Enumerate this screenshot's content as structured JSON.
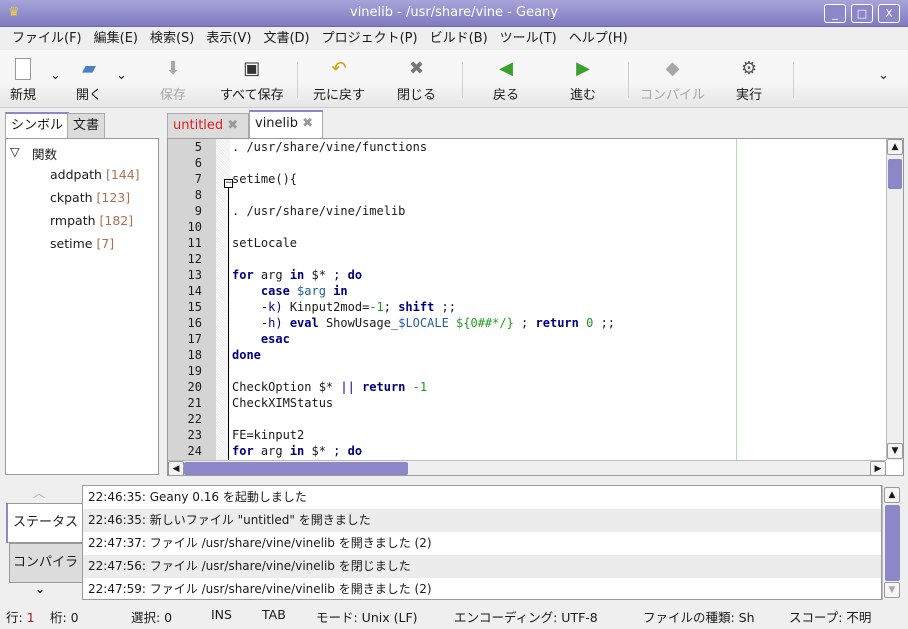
{
  "window": {
    "title": "vinelib - /usr/share/vine - Geany",
    "minimize": "_",
    "maximize": "□",
    "close": "X"
  },
  "menu": [
    "ファイル(F)",
    "編集(E)",
    "検索(S)",
    "表示(V)",
    "文書(D)",
    "プロジェクト(P)",
    "ビルド(B)",
    "ツール(T)",
    "ヘルプ(H)"
  ],
  "toolbar": {
    "new": "新規",
    "open": "開く",
    "save": "保存",
    "save_all": "すべて保存",
    "revert": "元に戻す",
    "close": "閉じる",
    "back": "戻る",
    "forward": "進む",
    "compile": "コンパイル",
    "run": "実行",
    "overflow": "⌄"
  },
  "sidebar": {
    "tabs": [
      "シンボル",
      "文書"
    ],
    "group": "関数",
    "symbols": [
      {
        "name": "addpath",
        "line": "[144]"
      },
      {
        "name": "ckpath",
        "line": "[123]"
      },
      {
        "name": "rmpath",
        "line": "[182]"
      },
      {
        "name": "setime",
        "line": "[7]"
      }
    ]
  },
  "editor": {
    "tabs": [
      {
        "label": "untitled",
        "color": "#e02020"
      },
      {
        "label": "vinelib",
        "color": "#000000"
      }
    ],
    "lines": [
      {
        "n": "5",
        "t": [
          [
            "p",
            ". /usr/share/vine/functions"
          ]
        ]
      },
      {
        "n": "6",
        "t": []
      },
      {
        "n": "7",
        "t": [
          [
            "p",
            "setime(){"
          ]
        ]
      },
      {
        "n": "8",
        "t": []
      },
      {
        "n": "9",
        "t": [
          [
            "p",
            ". /usr/share/vine/imelib"
          ]
        ]
      },
      {
        "n": "10",
        "t": []
      },
      {
        "n": "11",
        "t": [
          [
            "p",
            "setLocale"
          ]
        ]
      },
      {
        "n": "12",
        "t": []
      },
      {
        "n": "13",
        "t": [
          [
            "kw",
            "for"
          ],
          [
            "p",
            " arg "
          ],
          [
            "kw",
            "in"
          ],
          [
            "p",
            " $* "
          ],
          [
            "op",
            ";"
          ],
          [
            "p",
            " "
          ],
          [
            "kw",
            "do"
          ]
        ]
      },
      {
        "n": "14",
        "t": [
          [
            "p",
            "    "
          ],
          [
            "kw",
            "case"
          ],
          [
            "p",
            " "
          ],
          [
            "var",
            "$arg"
          ],
          [
            "p",
            " "
          ],
          [
            "kw",
            "in"
          ]
        ]
      },
      {
        "n": "15",
        "t": [
          [
            "p",
            "    "
          ],
          [
            "op",
            "-k)"
          ],
          [
            "p",
            " Kinput2mod="
          ],
          [
            "num",
            "-1"
          ],
          [
            "p",
            "; "
          ],
          [
            "kw",
            "shift"
          ],
          [
            "p",
            " ;;"
          ]
        ]
      },
      {
        "n": "16",
        "t": [
          [
            "p",
            "    "
          ],
          [
            "op",
            "-h)"
          ],
          [
            "p",
            " "
          ],
          [
            "kw",
            "eval"
          ],
          [
            "p",
            " ShowUsage_"
          ],
          [
            "var",
            "$LOCALE"
          ],
          [
            "p",
            " "
          ],
          [
            "prm",
            "${0##*/}"
          ],
          [
            "p",
            " ; "
          ],
          [
            "kw",
            "return"
          ],
          [
            "p",
            " "
          ],
          [
            "num",
            "0"
          ],
          [
            "p",
            " ;;"
          ]
        ]
      },
      {
        "n": "17",
        "t": [
          [
            "p",
            "    "
          ],
          [
            "kw",
            "esac"
          ]
        ]
      },
      {
        "n": "18",
        "t": [
          [
            "kw",
            "done"
          ]
        ]
      },
      {
        "n": "19",
        "t": []
      },
      {
        "n": "20",
        "t": [
          [
            "p",
            "CheckOption $* "
          ],
          [
            "op",
            "||"
          ],
          [
            "p",
            " "
          ],
          [
            "kw",
            "return"
          ],
          [
            "p",
            " "
          ],
          [
            "num",
            "-1"
          ]
        ]
      },
      {
        "n": "21",
        "t": [
          [
            "p",
            "CheckXIMStatus"
          ]
        ]
      },
      {
        "n": "22",
        "t": []
      },
      {
        "n": "23",
        "t": [
          [
            "p",
            "FE=kinput2"
          ]
        ]
      },
      {
        "n": "24",
        "t": [
          [
            "kw",
            "for"
          ],
          [
            "p",
            " arg "
          ],
          [
            "kw",
            "in"
          ],
          [
            "p",
            " $* "
          ],
          [
            "op",
            ";"
          ],
          [
            "p",
            " "
          ],
          [
            "kw",
            "do"
          ]
        ]
      }
    ]
  },
  "messages": {
    "tabs": [
      "ステータス",
      "コンパイラ"
    ],
    "items": [
      "22:46:35: Geany 0.16 を起動しました",
      "22:46:35: 新しいファイル \"untitled\" を開きました",
      "22:47:37: ファイル /usr/share/vine/vinelib を開きました (2)",
      "22:47:56: ファイル /usr/share/vine/vinelib を閉じました",
      "22:47:59: ファイル /usr/share/vine/vinelib を開きました (2)"
    ]
  },
  "status": {
    "line_label": "行:",
    "line": "1",
    "col": "桁: 0",
    "sel": "選択: 0",
    "ins": "INS",
    "tab": "TAB",
    "mode": "モード: Unix (LF)",
    "enc": "エンコーディング: UTF-8",
    "ftype": "ファイルの種類: Sh",
    "scope": "スコープ: 不明"
  },
  "colors": {
    "accent": "#8c88c8",
    "keyword": "#00007f",
    "number": "#209020"
  }
}
